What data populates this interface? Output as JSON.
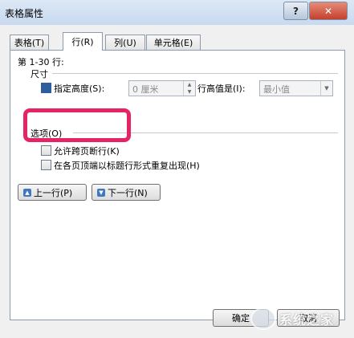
{
  "window": {
    "title": "表格属性"
  },
  "titlebar": {
    "help_label": "?",
    "close_label": "✕"
  },
  "tabs": [
    {
      "label": "表格(T)"
    },
    {
      "label": "行(R)"
    },
    {
      "label": "列(U)"
    },
    {
      "label": "单元格(E)"
    }
  ],
  "row_tab": {
    "rows_label": "第 1-30 行:",
    "size_section": "尺寸",
    "specify_height_label": "指定高度(S):",
    "height_value": "0 厘米",
    "row_height_is_label": "行高值是(I):",
    "row_height_mode": "最小值",
    "options_section": "选项(O)",
    "allow_break_label": "允许跨页断行(K)",
    "repeat_header_label": "在各页顶端以标题行形式重复出现(H)",
    "prev_row_label": "上一行(P)",
    "next_row_label": "下一行(N)"
  },
  "footer": {
    "ok_label": "确定",
    "cancel_label": "取消"
  },
  "watermark": {
    "text": "系统之家"
  },
  "colors": {
    "highlight": "#e52463",
    "checkbox_checked": "#2e5e9e"
  },
  "icons": {
    "prev": "arrow-up-icon",
    "next": "arrow-down-icon"
  }
}
